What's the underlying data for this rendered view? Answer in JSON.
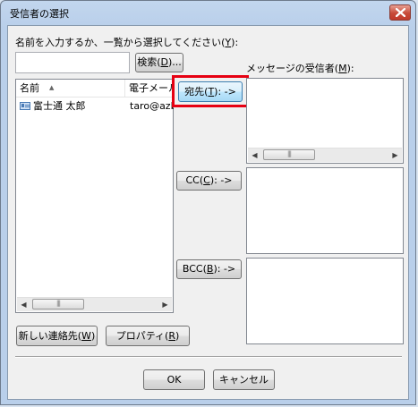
{
  "window": {
    "title": "受信者の選択"
  },
  "instruction": {
    "text_before": "名前を入力するか、一覧から選択してください(",
    "key": "Y",
    "text_after": "):"
  },
  "search": {
    "value": "",
    "button": {
      "text_before": "検索(",
      "key": "D",
      "text_after": ")..."
    }
  },
  "recipients_label": {
    "text_before": "メッセージの受信者(",
    "key": "M",
    "text_after": "):"
  },
  "contacts": {
    "columns": [
      "名前",
      "電子メール"
    ],
    "rows": [
      {
        "name": "富士通 太郎",
        "email": "taro@azby"
      }
    ]
  },
  "to_button": {
    "text_before": "宛先(",
    "key": "T",
    "text_after": "): ->"
  },
  "cc_button": {
    "text_before": "CC(",
    "key": "C",
    "text_after": "): ->"
  },
  "bcc_button": {
    "text_before": "BCC(",
    "key": "B",
    "text_after": "): ->"
  },
  "new_contact_button": {
    "text_before": "新しい連絡先(",
    "key": "W",
    "text_after": ")"
  },
  "properties_button": {
    "text_before": "プロパティ(",
    "key": "R",
    "text_after": ")"
  },
  "ok_button": {
    "label": "OK"
  },
  "cancel_button": {
    "label": "キャンセル"
  },
  "colors": {
    "highlight": "#e60012",
    "title_bar": "#b9cfea",
    "client_bg": "#f0f0f0"
  }
}
